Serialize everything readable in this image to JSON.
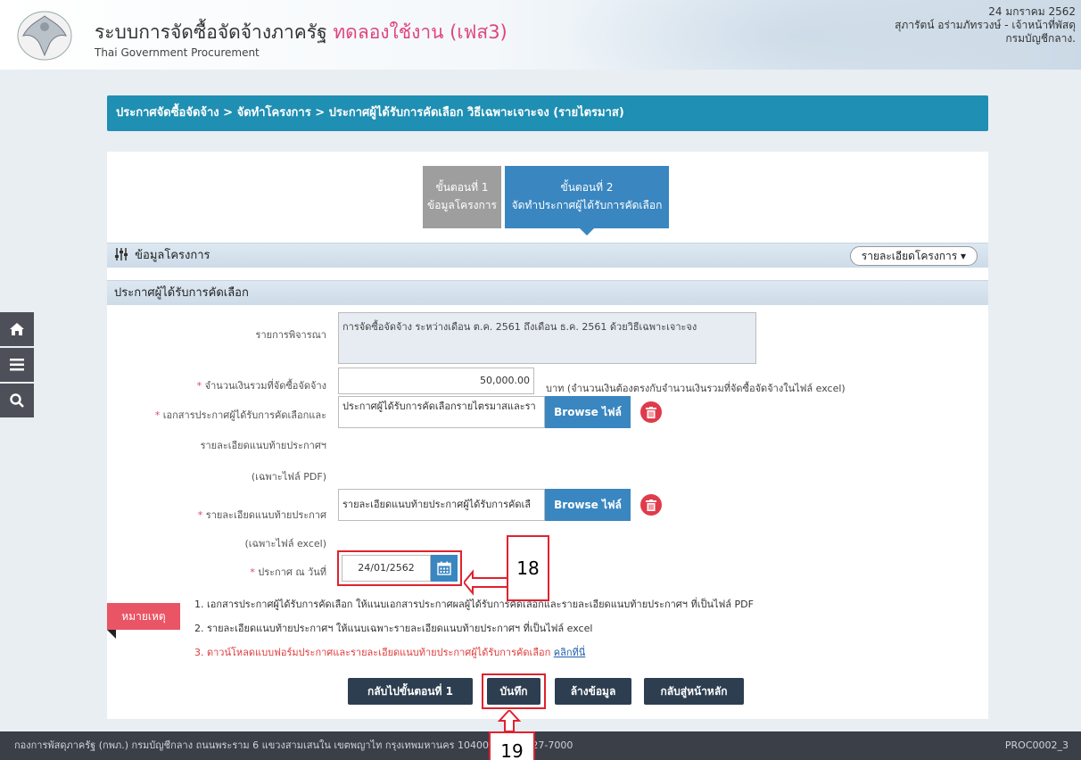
{
  "header": {
    "title": "ระบบการจัดซื้อจัดจ้างภาครัฐ",
    "trial_label": "ทดลองใช้งาน (เฟส3)",
    "subtitle": "Thai Government Procurement",
    "date": "24 มกราคม 2562",
    "user": "สุภารัตน์ อร่ามภัทรวงษ์ - เจ้าหน้าที่พัสดุ",
    "department": "กรมบัญชีกลาง."
  },
  "quicknav": {
    "items": [
      "home-icon",
      "menu-icon",
      "search-icon"
    ]
  },
  "breadcrumb": "ประกาศจัดซื้อจัดจ้าง > จัดทำโครงการ > ประกาศผู้ได้รับการคัดเลือก วิธีเฉพาะเจาะจง (รายไตรมาส)",
  "steps": [
    {
      "title": "ขั้นตอนที่ 1",
      "label": "ข้อมูลโครงการ"
    },
    {
      "title": "ขั้นตอนที่ 2",
      "label": "จัดทำประกาศผู้ได้รับการคัดเลือก"
    }
  ],
  "project_section": {
    "title": "ข้อมูลโครงการ",
    "detail_button": "รายละเอียดโครงการ"
  },
  "announce_section": {
    "title": "ประกาศผู้ได้รับการคัดเลือก"
  },
  "form": {
    "consideration_label": "รายการพิจารณา",
    "consideration_value": "การจัดซื้อจัดจ้าง ระหว่างเดือน ต.ค. 2561 ถึงเดือน ธ.ค. 2561 ด้วยวิธีเฉพาะเจาะจง",
    "amount_label": "จำนวนเงินรวมที่จัดซื้อจัดจ้าง",
    "amount_value": "50,000.00",
    "amount_hint": "บาท (จำนวนเงินต้องตรงกับจำนวนเงินรวมที่จัดซื้อจัดจ้างในไฟล์ excel)",
    "doc_label_1": "เอกสารประกาศผู้ได้รับการคัดเลือกและ",
    "doc_label_2": "รายละเอียดแนบท้ายประกาศฯ",
    "doc_label_3": "(เฉพาะไฟล์ PDF)",
    "doc_value": "ประกาศผู้ได้รับการคัดเลือกรายไตรมาสและรา",
    "attach_label": "รายละเอียดแนบท้ายประกาศ",
    "attach_label_2": "(เฉพาะไฟล์ excel)",
    "attach_value": "รายละเอียดแนบท้ายประกาศผู้ได้รับการคัดเลื",
    "browse_label": "Browse ไฟล์",
    "date_label": "ประกาศ ณ วันที่",
    "date_value": "24/01/2562",
    "required_mark": "*"
  },
  "notes": {
    "tab": "หมายเหตุ",
    "line1": "1. เอกสารประกาศผู้ได้รับการคัดเลือก ให้แนบเอกสารประกาศผลผู้ได้รับการคัดเลือกและรายละเอียดแนบท้ายประกาศฯ ที่เป็นไฟล์ PDF",
    "line2": "2. รายละเอียดแนบท้ายประกาศฯ ให้แนบเฉพาะรายละเอียดแนบท้ายประกาศฯ ที่เป็นไฟล์ excel",
    "line3": "3. ดาวน์โหลดแบบฟอร์มประกาศและรายละเอียดแนบท้ายประกาศผู้ได้รับการคัดเลือก",
    "line3_link": "คลิกที่นี่"
  },
  "buttons": {
    "back_step1": "กลับไปขั้นตอนที่ 1",
    "save": "บันทึก",
    "clear": "ล้างข้อมูล",
    "home": "กลับสู่หน้าหลัก"
  },
  "callouts": {
    "date": "18",
    "save": "19"
  },
  "footer": {
    "text": "กองการพัสดุภาครัฐ (กพภ.) กรมบัญชีกลาง ถนนพระราม 6 แขวงสามเสนใน เขตพญาไท กรุงเทพมหานคร 10400 โ",
    "text_end": "27-7000",
    "code": "PROC0002_3"
  },
  "colors": {
    "accent_blue": "#1f8fb3",
    "step_active": "#3a86c0",
    "note_red": "#ea5565",
    "button_dark": "#2d3e50",
    "annotation_red": "#e0222e"
  }
}
